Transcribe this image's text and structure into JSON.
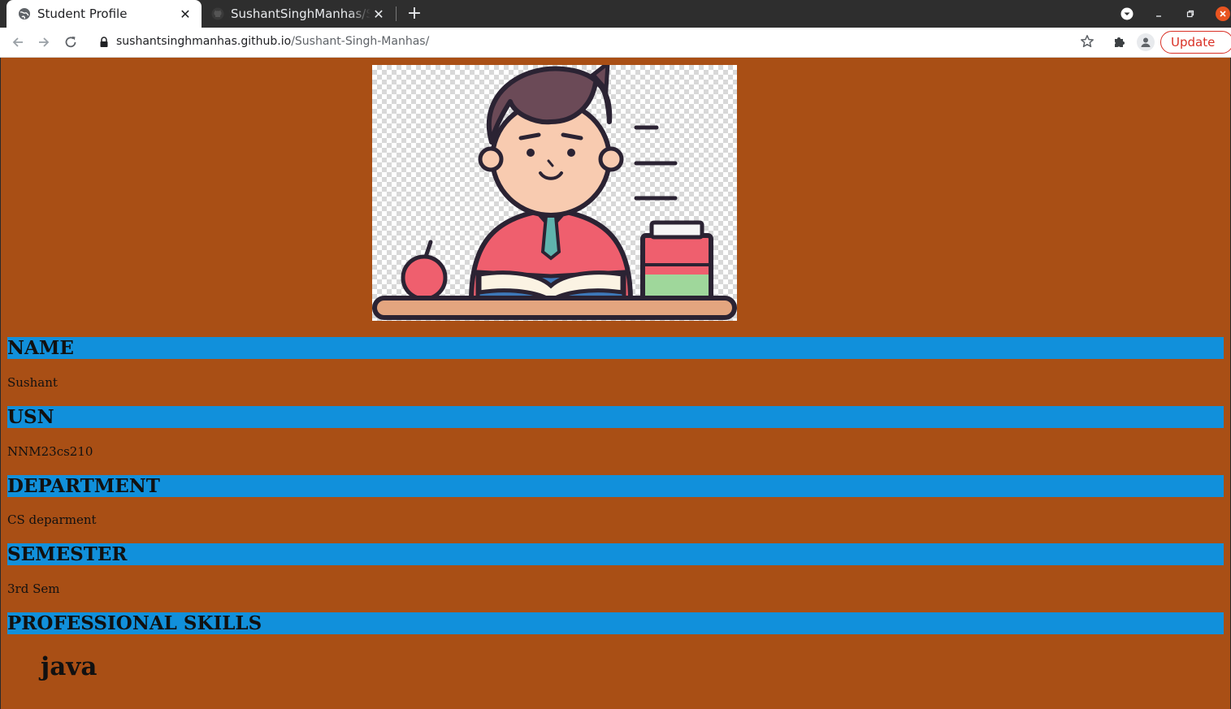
{
  "browser": {
    "tabs": [
      {
        "title": "Student Profile",
        "active": true
      },
      {
        "title": "SushantSinghManhas/Sushant-Singh-Manhas",
        "active": false
      }
    ],
    "new_tab_symbol": "+",
    "close_symbol": "✕",
    "url": {
      "host": "sushantsinghmanhas.github.io",
      "path": "/Sushant-Singh-Manhas/"
    },
    "update_label": "Update",
    "icons": [
      "globe-icon",
      "github-icon",
      "back-arrow-icon",
      "forward-arrow-icon",
      "reload-icon",
      "lock-icon",
      "star-icon",
      "extensions-icon",
      "profile-icon",
      "menu-dots-icon",
      "tab-search-icon",
      "minimize-icon",
      "restore-icon",
      "close-window-icon"
    ]
  },
  "colors": {
    "page_bg": "#a94f15",
    "section_bar": "#1190db",
    "update_red": "#d93025"
  },
  "profile": {
    "image": "student-illustration",
    "sections": [
      {
        "heading": "NAME",
        "value": "Sushant"
      },
      {
        "heading": "USN",
        "value": "NNM23cs210"
      },
      {
        "heading": "DEPARTMENT",
        "value": "CS deparment"
      },
      {
        "heading": "SEMESTER",
        "value": "3rd Sem"
      },
      {
        "heading": "PROFESSIONAL SKILLS",
        "value": ""
      }
    ],
    "skills": [
      "java"
    ]
  }
}
